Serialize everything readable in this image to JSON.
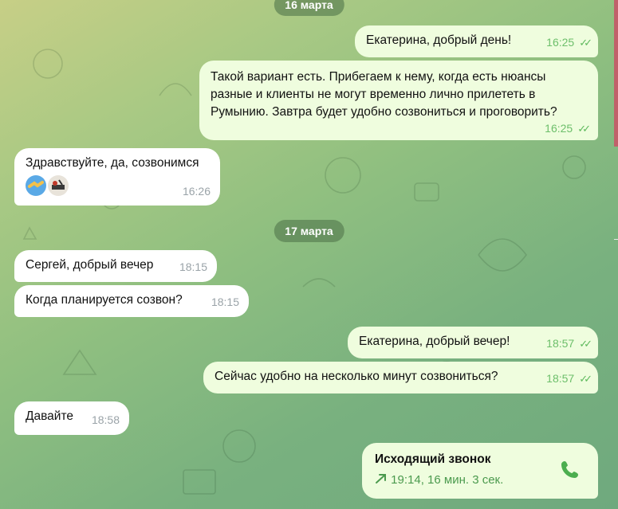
{
  "dates": {
    "d1": "16 марта",
    "d2": "17 марта"
  },
  "messages": {
    "m1": {
      "text": "Екатерина, добрый день!",
      "time": "16:25"
    },
    "m2": {
      "text": "Такой вариант есть. Прибегаем к нему, когда есть нюансы разные и клиенты не могут временно лично прилететь в Румынию. Завтра будет удобно созвониться и проговорить?",
      "time": "16:25"
    },
    "m3": {
      "text": "Здравствуйте, да, созвонимся",
      "time": "16:26"
    },
    "m4": {
      "text": "Сергей, добрый вечер",
      "time": "18:15"
    },
    "m5": {
      "text": "Когда планируется созвон?",
      "time": "18:15"
    },
    "m6": {
      "text": "Екатерина, добрый вечер!",
      "time": "18:57"
    },
    "m7": {
      "text": "Сейчас удобно на несколько минут созвониться?",
      "time": "18:57"
    },
    "m8": {
      "text": "Давайте",
      "time": "18:58"
    }
  },
  "call": {
    "title": "Исходящий звонок",
    "details": "19:14, 16 мин. 3 сек."
  },
  "icons": {
    "read": "double-check-icon",
    "call": "phone-icon",
    "arrow": "outgoing-arrow-icon"
  },
  "colors": {
    "out_bubble": "#effdde",
    "in_bubble": "#ffffff",
    "accent": "#5fba5d"
  }
}
